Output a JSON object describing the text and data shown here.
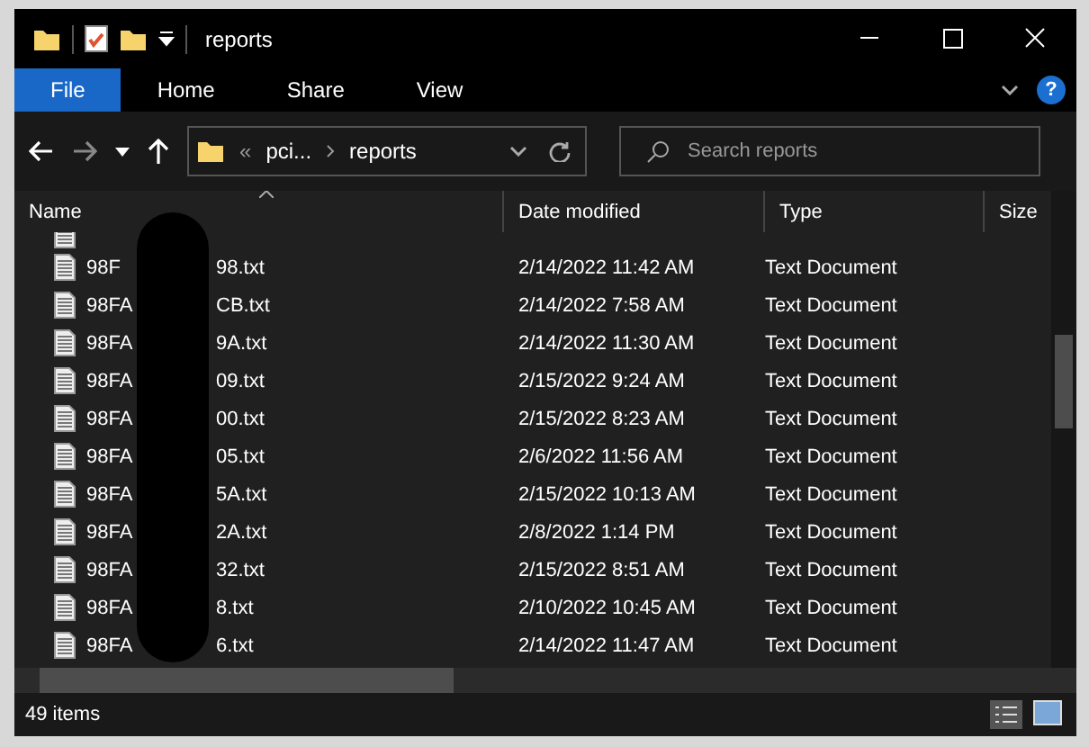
{
  "window": {
    "title": "reports"
  },
  "ribbon": {
    "tabs": [
      {
        "label": "File",
        "selected": true
      },
      {
        "label": "Home",
        "selected": false
      },
      {
        "label": "Share",
        "selected": false
      },
      {
        "label": "View",
        "selected": false
      }
    ]
  },
  "address": {
    "overflow": "«",
    "crumbs": [
      "pci...",
      "reports"
    ]
  },
  "search": {
    "placeholder": "Search reports"
  },
  "table": {
    "columns": [
      "Name",
      "Date modified",
      "Type",
      "Size"
    ],
    "rows": [
      {
        "name_start": "98F",
        "name_end": "98.txt",
        "date": "2/14/2022 11:42 AM",
        "type": "Text Document"
      },
      {
        "name_start": "98FA",
        "name_end": "CB.txt",
        "date": "2/14/2022 7:58 AM",
        "type": "Text Document"
      },
      {
        "name_start": "98FA",
        "name_end": "9A.txt",
        "date": "2/14/2022 11:30 AM",
        "type": "Text Document"
      },
      {
        "name_start": "98FA",
        "name_end": "09.txt",
        "date": "2/15/2022 9:24 AM",
        "type": "Text Document"
      },
      {
        "name_start": "98FA",
        "name_end": "00.txt",
        "date": "2/15/2022 8:23 AM",
        "type": "Text Document"
      },
      {
        "name_start": "98FA",
        "name_end": "05.txt",
        "date": "2/6/2022 11:56 AM",
        "type": "Text Document"
      },
      {
        "name_start": "98FA",
        "name_end": "5A.txt",
        "date": "2/15/2022 10:13 AM",
        "type": "Text Document"
      },
      {
        "name_start": "98FA",
        "name_end": "2A.txt",
        "date": "2/8/2022 1:14 PM",
        "type": "Text Document"
      },
      {
        "name_start": "98FA",
        "name_end": "32.txt",
        "date": "2/15/2022 8:51 AM",
        "type": "Text Document"
      },
      {
        "name_start": "98FA",
        "name_end": "8.txt",
        "date": "2/10/2022 10:45 AM",
        "type": "Text Document"
      },
      {
        "name_start": "98FA",
        "name_end": "6.txt",
        "date": "2/14/2022 11:47 AM",
        "type": "Text Document"
      }
    ]
  },
  "status_bar": {
    "count": "49 items"
  },
  "help": "?"
}
